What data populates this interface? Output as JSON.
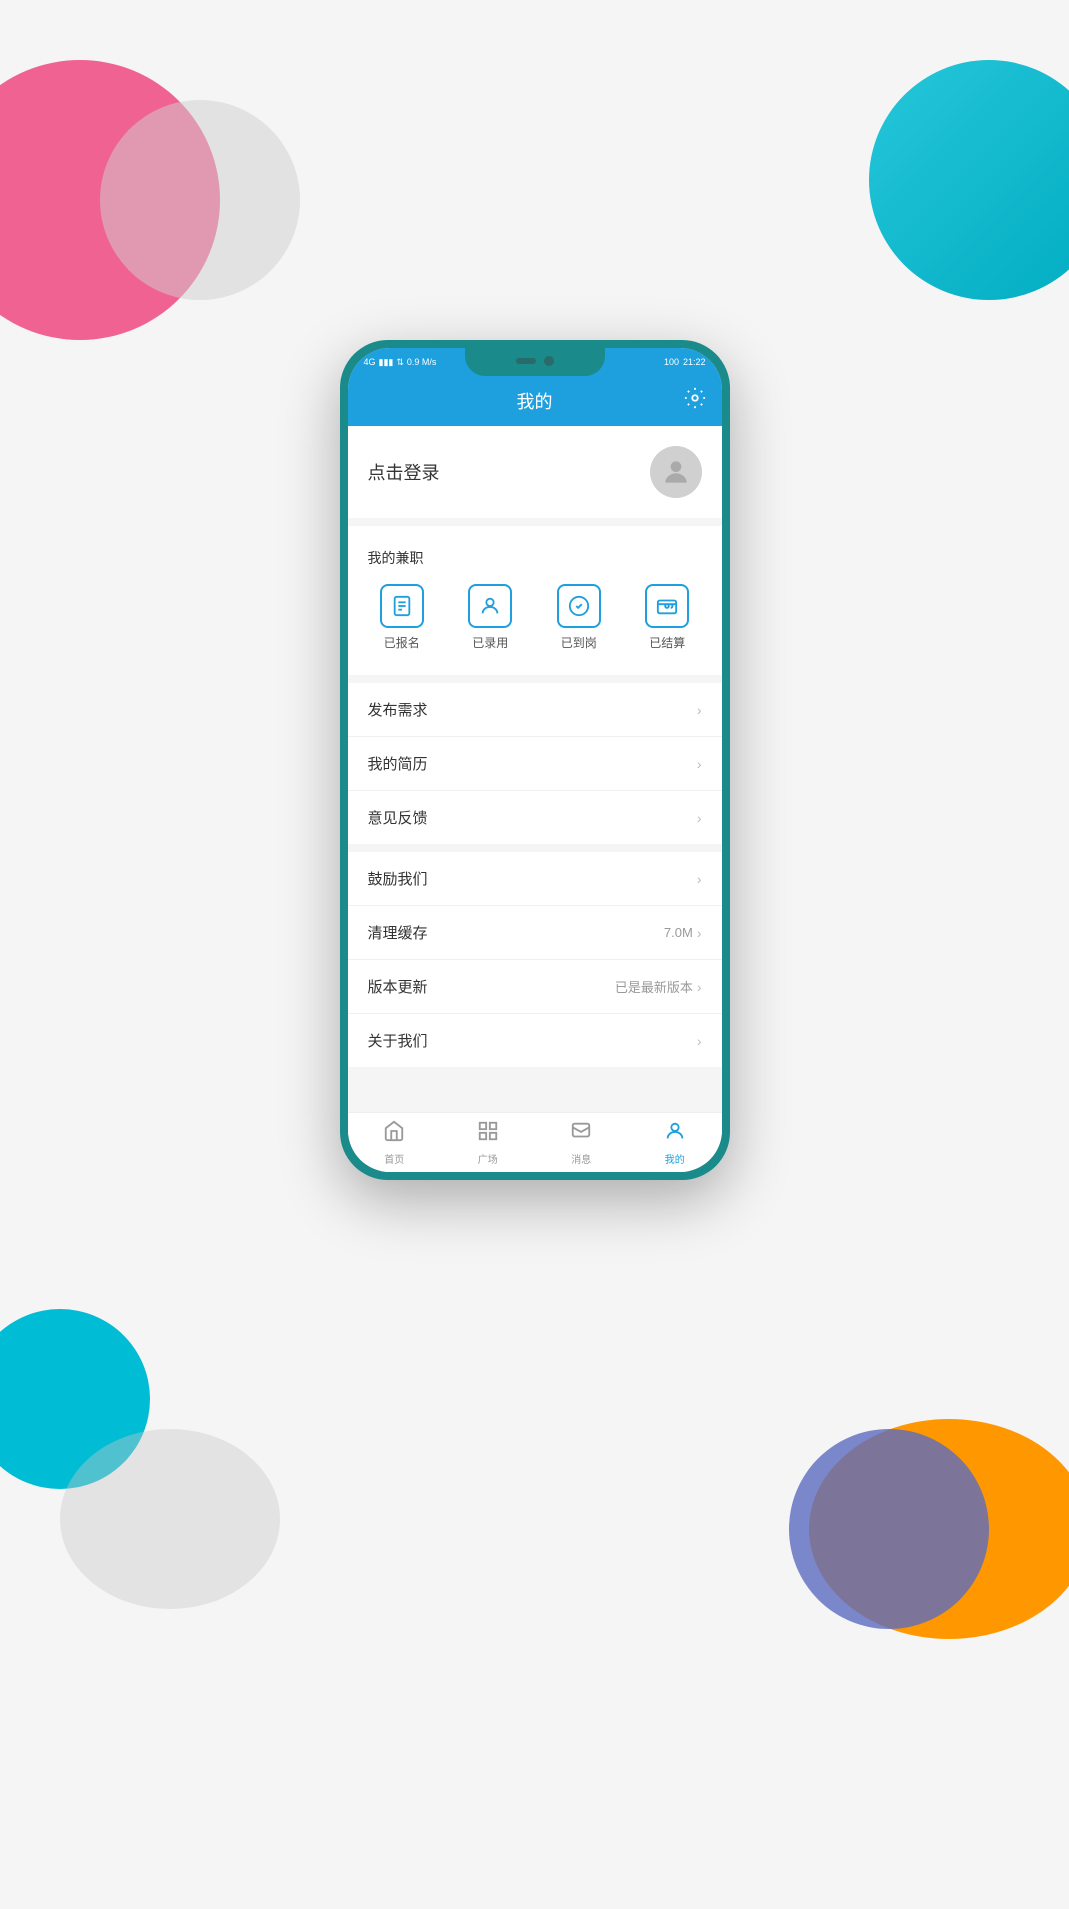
{
  "background": {
    "circles": [
      "pink",
      "gray-top",
      "teal-top",
      "cyan-bottom-left",
      "gray-bottom",
      "orange-bottom",
      "blue-bottom"
    ]
  },
  "status_bar": {
    "left_signal": "4G",
    "speed": "0.9 M/s",
    "battery": "100",
    "time": "21:22"
  },
  "header": {
    "title": "我的",
    "settings_icon": "gear-icon"
  },
  "login": {
    "text": "点击登录"
  },
  "parttime": {
    "section_label": "我的兼职",
    "items": [
      {
        "label": "已报名",
        "icon": "📋"
      },
      {
        "label": "已录用",
        "icon": "👤"
      },
      {
        "label": "已到岗",
        "icon": "✅"
      },
      {
        "label": "已结算",
        "icon": "💳"
      }
    ]
  },
  "menu": {
    "items": [
      {
        "label": "发布需求",
        "right_text": "",
        "has_chevron": true
      },
      {
        "label": "我的简历",
        "right_text": "",
        "has_chevron": true
      },
      {
        "label": "意见反馈",
        "right_text": "",
        "has_chevron": true
      },
      {
        "label": "鼓励我们",
        "right_text": "",
        "has_chevron": true
      },
      {
        "label": "清理缓存",
        "right_text": "7.0M",
        "has_chevron": true
      },
      {
        "label": "版本更新",
        "right_text": "已是最新版本",
        "has_chevron": true
      },
      {
        "label": "关于我们",
        "right_text": "",
        "has_chevron": true
      }
    ]
  },
  "bottom_nav": {
    "items": [
      {
        "label": "首页",
        "icon": "⌂",
        "active": false
      },
      {
        "label": "广场",
        "icon": "⊞",
        "active": false
      },
      {
        "label": "消息",
        "icon": "▦",
        "active": false
      },
      {
        "label": "我的",
        "icon": "☺",
        "active": true
      }
    ]
  }
}
